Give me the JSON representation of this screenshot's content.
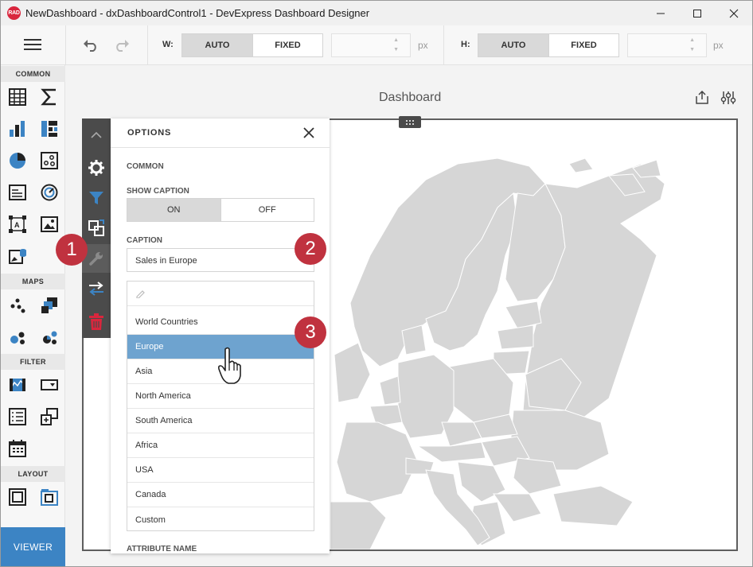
{
  "window": {
    "logo_text": "RAD",
    "title": "NewDashboard - dxDashboardControl1 - DevExpress Dashboard Designer"
  },
  "toolbar": {
    "width_label": "W:",
    "height_label": "H:",
    "auto_label": "AUTO",
    "fixed_label": "FIXED",
    "unit": "px",
    "width_mode_selected": "AUTO",
    "height_mode_selected": "AUTO"
  },
  "toolbox": {
    "sections": {
      "common": "COMMON",
      "maps": "MAPS",
      "filter": "FILTER",
      "layout": "LAYOUT"
    },
    "viewer_label": "VIEWER"
  },
  "dashboard": {
    "title": "Dashboard"
  },
  "options": {
    "title": "OPTIONS",
    "common_label": "COMMON",
    "show_caption_label": "SHOW CAPTION",
    "toggle_on": "ON",
    "toggle_off": "OFF",
    "show_caption_value": "ON",
    "caption_label": "CAPTION",
    "caption_value": "Sales in Europe",
    "map_options": [
      "World Countries",
      "Europe",
      "Asia",
      "North America",
      "South America",
      "Africa",
      "USA",
      "Canada",
      "Custom"
    ],
    "selected_map": "Europe",
    "attribute_name_label": "ATTRIBUTE NAME"
  },
  "badges": [
    "1",
    "2",
    "3"
  ],
  "colors": {
    "accent": "#3c84c4",
    "selected_row": "#6ea3cf",
    "badge": "#c0323f",
    "strip": "#4b4b4b",
    "map_fill": "#d6d6d6"
  }
}
